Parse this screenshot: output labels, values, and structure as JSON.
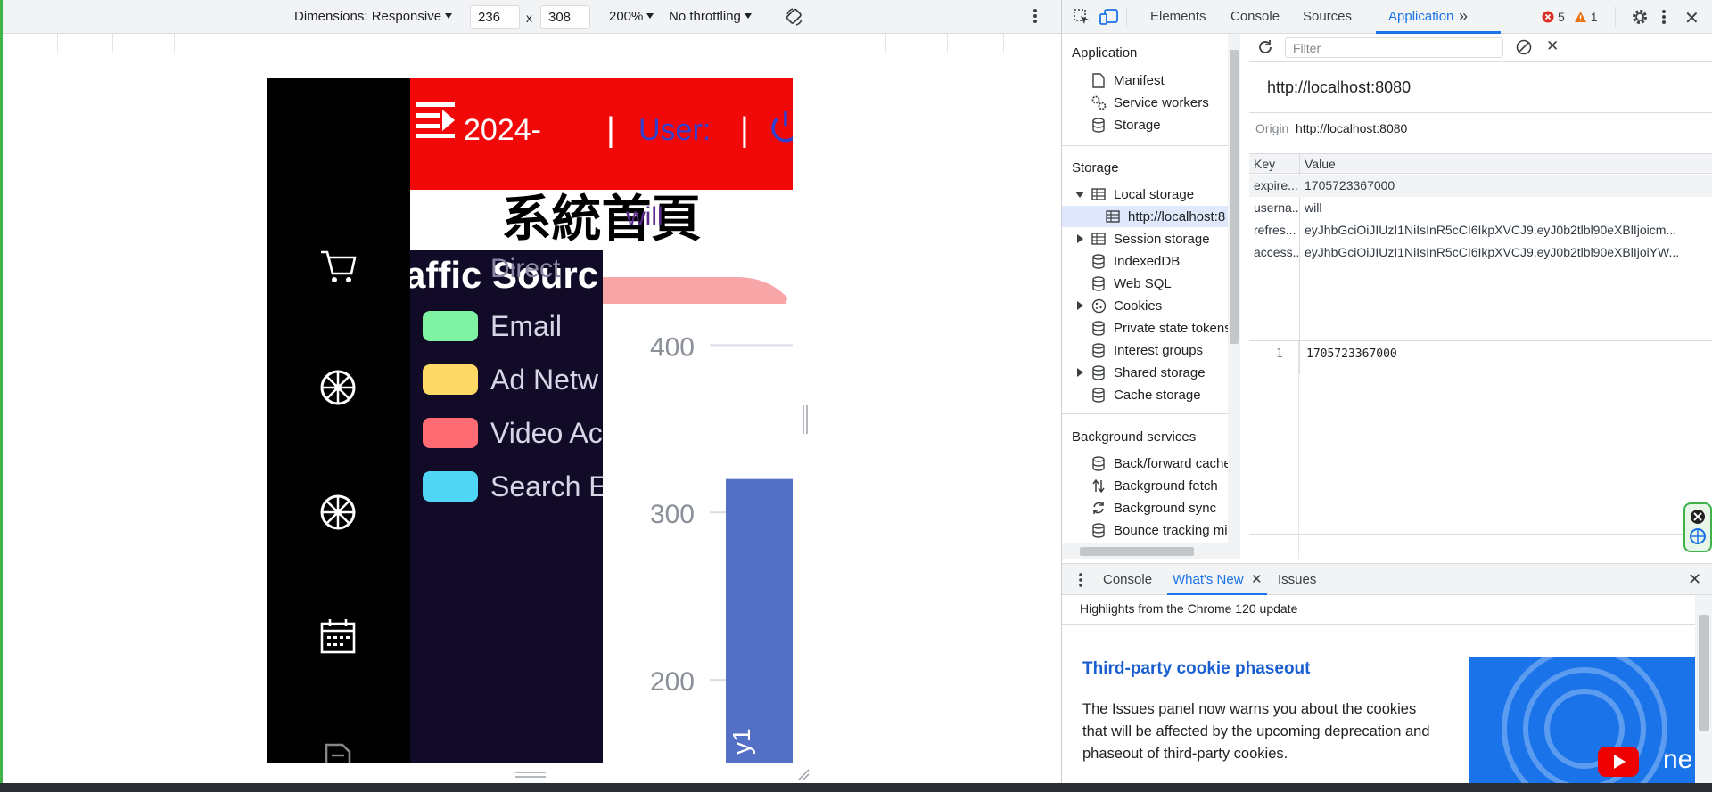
{
  "device_toolbar": {
    "dimensions_label": "Dimensions: Responsive",
    "width_value": "236",
    "times_symbol": "x",
    "height_value": "308",
    "zoom_label": "200%",
    "throttle_label": "No throttling"
  },
  "emulated_page": {
    "header": {
      "date_text": "2024-",
      "separator": "|",
      "user_label": "User:"
    },
    "title": "系統首頁",
    "overlay_text": "will",
    "legend_heading": "affic Sourc",
    "legend_partial": "Direct",
    "legend": [
      {
        "label": "Email",
        "color": "#7ef3a4"
      },
      {
        "label": "Ad Netw",
        "color": "#ffd966"
      },
      {
        "label": "Video Ac",
        "color": "#ff6b73"
      },
      {
        "label": "Search Er",
        "color": "#4fd6f5"
      }
    ],
    "chart": {
      "bar_label": "y1",
      "colors": {
        "bar": "#5470c6",
        "pink": "#f8a5a8"
      }
    },
    "chart_data": {
      "type": "bar",
      "categories": [
        "y1"
      ],
      "series": [
        {
          "values": [
            320
          ]
        }
      ],
      "yticks": [
        "400",
        "300",
        "200"
      ],
      "ylim": [
        150,
        430
      ]
    }
  },
  "devtools": {
    "tabs": [
      "Elements",
      "Console",
      "Sources",
      "Application"
    ],
    "active_tab": "Application",
    "error_count": "5",
    "warning_count": "1",
    "sidebar": {
      "application_header": "Application",
      "application_items": [
        "Manifest",
        "Service workers",
        "Storage"
      ],
      "storage_header": "Storage",
      "storage_items": [
        "Local storage",
        "http://localhost:8",
        "Session storage",
        "IndexedDB",
        "Web SQL",
        "Cookies",
        "Private state tokens",
        "Interest groups",
        "Shared storage",
        "Cache storage"
      ],
      "background_header": "Background services",
      "background_items": [
        "Back/forward cache",
        "Background fetch",
        "Background sync",
        "Bounce tracking mi"
      ]
    },
    "storage_panel": {
      "filter_placeholder": "Filter",
      "origin_title": "http://localhost:8080",
      "origin_label": "Origin",
      "origin_value": "http://localhost:8080",
      "col_key": "Key",
      "col_value": "Value",
      "rows": [
        {
          "key": "expire...",
          "value": "1705723367000"
        },
        {
          "key": "userna...",
          "value": "will"
        },
        {
          "key": "refres...",
          "value": "eyJhbGciOiJIUzI1NiIsInR5cCI6IkpXVCJ9.eyJ0b2tlbl90eXBlIjoicm..."
        },
        {
          "key": "access...",
          "value": "eyJhbGciOiJIUzI1NiIsInR5cCI6IkpXVCJ9.eyJ0b2tlbl90eXBlIjoiYW..."
        }
      ],
      "preview_line_no": "1",
      "preview_value": "1705723367000"
    },
    "drawer": {
      "tabs": [
        "Console",
        "What's New",
        "Issues"
      ],
      "active_tab": "What's New",
      "highlight": "Highlights from the Chrome 120 update",
      "article_title": "Third-party cookie phaseout",
      "article_body": "The Issues panel now warns you about the cookies that will be affected by the upcoming deprecation and phaseout of third-party cookies.",
      "thumb_text": "ne"
    }
  }
}
